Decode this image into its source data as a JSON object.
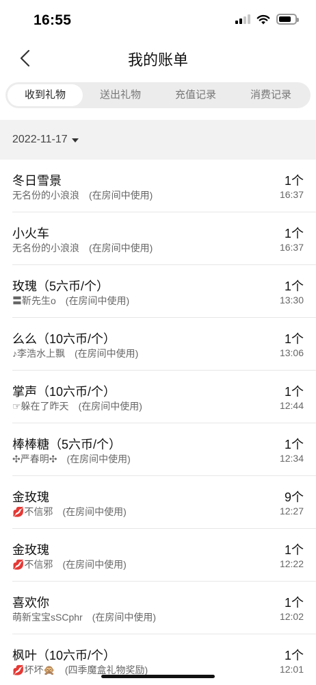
{
  "status_bar": {
    "time": "16:55"
  },
  "nav": {
    "title": "我的账单",
    "back_icon": "chevron-left-icon"
  },
  "tabs": [
    {
      "label": "收到礼物",
      "active": true
    },
    {
      "label": "送出礼物",
      "active": false
    },
    {
      "label": "充值记录",
      "active": false
    },
    {
      "label": "消费记录",
      "active": false
    }
  ],
  "date_filter": {
    "value": "2022-11-17"
  },
  "records": [
    {
      "name": "冬日雪景",
      "sender": "无名份的小浪浪",
      "note": "(在房间中使用)",
      "count": "1个",
      "time": "16:37"
    },
    {
      "name": "小火车",
      "sender": "无名份的小浪浪",
      "note": "(在房间中使用)",
      "count": "1个",
      "time": "16:37"
    },
    {
      "name": "玫瑰（5六币/个）",
      "sender": "〓靳先生o",
      "note": "(在房间中使用)",
      "count": "1个",
      "time": "13:30"
    },
    {
      "name": "么么（10六币/个）",
      "sender": "♪李浩水上飘",
      "note": "(在房间中使用)",
      "count": "1个",
      "time": "13:06"
    },
    {
      "name": "掌声（10六币/个）",
      "sender": "☞躲在了昨天",
      "note": "(在房间中使用)",
      "count": "1个",
      "time": "12:44"
    },
    {
      "name": "棒棒糖（5六币/个）",
      "sender": "✣严春明✣",
      "note": "(在房间中使用)",
      "count": "1个",
      "time": "12:34"
    },
    {
      "name": "金玫瑰",
      "sender": "💋不信邪",
      "note": "(在房间中使用)",
      "count": "9个",
      "time": "12:27"
    },
    {
      "name": "金玫瑰",
      "sender": "💋不信邪",
      "note": "(在房间中使用)",
      "count": "1个",
      "time": "12:22"
    },
    {
      "name": "喜欢你",
      "sender": "萌新宝宝sSCphr",
      "note": "(在房间中使用)",
      "count": "1个",
      "time": "12:02"
    },
    {
      "name": "枫叶（10六币/个）",
      "sender": "💋坏坏🙊",
      "note": "(四季魔盒礼物奖励)",
      "count": "1个",
      "time": "12:01"
    }
  ]
}
